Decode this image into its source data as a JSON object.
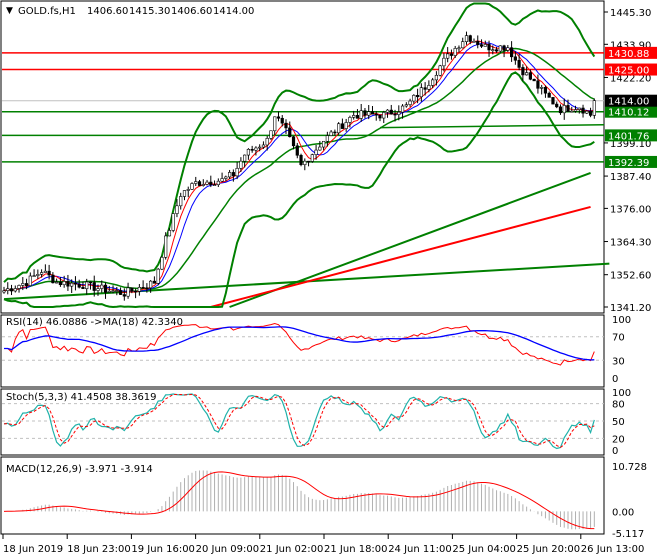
{
  "header": {
    "symbol": "GOLD.fs,H1",
    "open": "1406.60",
    "high": "1415.30",
    "low": "1406.60",
    "close": "1414.00"
  },
  "chart_data": {
    "type": "candlestick",
    "title": "GOLD.fs,H1",
    "bars": 158,
    "price_keypoints": [
      [
        0,
        1347
      ],
      [
        6,
        1350
      ],
      [
        10,
        1354
      ],
      [
        14,
        1350
      ],
      [
        21,
        1349
      ],
      [
        28,
        1347
      ],
      [
        32,
        1346
      ],
      [
        38,
        1349
      ],
      [
        40,
        1350
      ],
      [
        43,
        1365
      ],
      [
        47,
        1381
      ],
      [
        51,
        1385
      ],
      [
        58,
        1386
      ],
      [
        61,
        1388
      ],
      [
        64,
        1395
      ],
      [
        70,
        1400
      ],
      [
        72,
        1409
      ],
      [
        75,
        1403
      ],
      [
        77,
        1397
      ],
      [
        79,
        1391
      ],
      [
        85,
        1400
      ],
      [
        93,
        1409
      ],
      [
        101,
        1409
      ],
      [
        107,
        1412
      ],
      [
        112,
        1419
      ],
      [
        117,
        1428
      ],
      [
        121,
        1434
      ],
      [
        123,
        1437
      ],
      [
        128,
        1433
      ],
      [
        134,
        1433
      ],
      [
        137,
        1426
      ],
      [
        144,
        1416
      ],
      [
        148,
        1411
      ],
      [
        153,
        1412
      ],
      [
        156,
        1409
      ],
      [
        157,
        1414
      ]
    ],
    "ylim": [
      1341.2,
      1445.3
    ],
    "y_ticks": [
      "1445.30",
      "1433.90",
      "1422.20",
      "1399.10",
      "1387.40",
      "1376.00",
      "1364.30",
      "1352.60",
      "1341.20"
    ],
    "x_ticks": [
      "18 Jun 2019",
      "18 Jun 23:00",
      "19 Jun 16:00",
      "20 Jun 09:00",
      "21 Jun 02:00",
      "21 Jun 18:00",
      "24 Jun 11:00",
      "25 Jun 04:00",
      "25 Jun 20:00",
      "26 Jun 13:00"
    ],
    "levels": [
      {
        "value": 1430.88,
        "label": "1430.88",
        "color": "#ff0000"
      },
      {
        "value": 1425.0,
        "label": "1425.00",
        "color": "#ff0000"
      },
      {
        "value": 1410.12,
        "label": "1410.12",
        "color": "#008000"
      },
      {
        "value": 1401.76,
        "label": "1401.76",
        "color": "#008000"
      },
      {
        "value": 1392.39,
        "label": "1392.39",
        "color": "#008000"
      }
    ],
    "current_price": {
      "value": 1414.0,
      "label": "1414.00"
    },
    "long_lines": [
      {
        "color": "#008000",
        "from": [
          0,
          1344
        ],
        "to": [
          161,
          1356.5
        ]
      },
      {
        "color": "#008000",
        "from": [
          60,
          1341.2
        ],
        "to": [
          156,
          1388.5
        ]
      },
      {
        "color": "#ff0000",
        "from": [
          55,
          1341.2
        ],
        "to": [
          156,
          1376.5
        ]
      }
    ],
    "rsi": {
      "label": "RSI(14) 46.0886  ->MA(18) 42.3340",
      "ticks": [
        "100",
        "70",
        "30",
        "0"
      ]
    },
    "stoch": {
      "label": "Stoch(5,3,3) 41.4508 38.3619",
      "ticks": [
        "100",
        "80",
        "50",
        "20",
        "0"
      ]
    },
    "macd": {
      "label": "MACD(12,26,9) -3.971 -3.914",
      "ticks": [
        "10.728",
        "0.00",
        "-5.117"
      ],
      "range": [
        -5.117,
        10.728
      ]
    }
  }
}
